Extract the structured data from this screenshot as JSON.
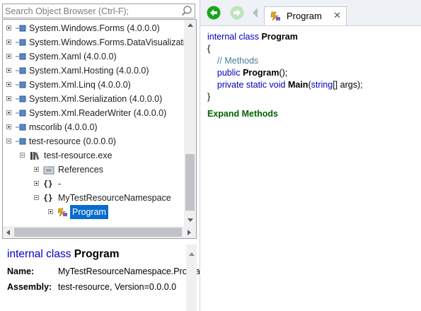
{
  "search": {
    "placeholder": "Search Object Browser (Ctrl-F);"
  },
  "tree": {
    "assemblies": [
      {
        "label": "System.Windows.Forms (4.0.0.0)"
      },
      {
        "label": "System.Windows.Forms.DataVisualization"
      },
      {
        "label": "System.Xaml (4.0.0.0)"
      },
      {
        "label": "System.Xaml.Hosting (4.0.0.0)"
      },
      {
        "label": "System.Xml.Linq (4.0.0.0)"
      },
      {
        "label": "System.Xml.Serialization (4.0.0.0)"
      },
      {
        "label": "System.Xml.ReaderWriter (4.0.0.0)"
      },
      {
        "label": "mscorlib (4.0.0.0)"
      },
      {
        "label": "test-resource (0.0.0.0)"
      }
    ],
    "module": "test-resource.exe",
    "references": "References",
    "ns_empty": "-",
    "namespace": "MyTestResourceNamespace",
    "class": "Program"
  },
  "description": {
    "keyword": "internal class",
    "name": "Program",
    "fields": [
      {
        "label": "Name:",
        "value": "MyTestResourceNamespace.Program"
      },
      {
        "label": "Assembly:",
        "value": "test-resource, Version=0.0.0.0"
      }
    ]
  },
  "tab": {
    "label": "Program",
    "close": "✕"
  },
  "code": {
    "decl_kw": "internal class",
    "decl_name": "Program",
    "open": "{",
    "comment": "// Methods",
    "ctor_kw": "public",
    "ctor_name": "Program",
    "ctor_rest": "();",
    "main_kw": "private static void",
    "main_name": "Main",
    "main_args_open": "(",
    "main_args_type": "string",
    "main_args_rest": "[] args);",
    "close": "}"
  },
  "expand_label": "Expand Methods",
  "colors": {
    "keyword": "#0000c0",
    "selection": "#0a6cce",
    "link": "#006400",
    "nav_back": "#1aa61a"
  }
}
